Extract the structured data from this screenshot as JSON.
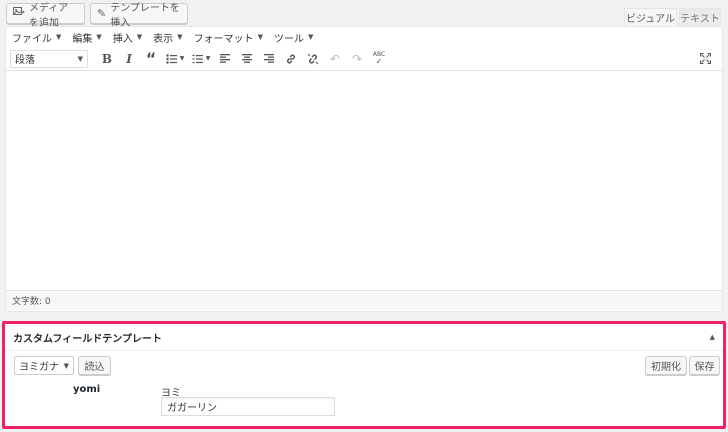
{
  "top_buttons": {
    "add_media": "メディアを追加",
    "insert_template": "テンプレートを挿入"
  },
  "mode_tabs": {
    "visual": "ビジュアル",
    "text": "テキスト"
  },
  "menubar": {
    "items": [
      "ファイル",
      "編集",
      "挿入",
      "表示",
      "フォーマット",
      "ツール"
    ]
  },
  "toolbar": {
    "format_value": "段落",
    "icons": [
      "bold-icon",
      "italic-icon",
      "blockquote-icon",
      "bullet-list-icon",
      "numbered-list-icon",
      "align-left-icon",
      "align-center-icon",
      "align-right-icon",
      "link-icon",
      "unlink-icon",
      "undo-icon",
      "redo-icon",
      "spellcheck-icon",
      "fullscreen-icon"
    ],
    "spellcheck_text": "ABC"
  },
  "status_bar": {
    "word_count": "文字数: 0"
  },
  "custom_field_template": {
    "title": "カスタムフィールドテンプレート",
    "template_select": "ヨミガナ",
    "load_button": "読込",
    "reset_button": "初期化",
    "save_button": "保存",
    "field_key": "yomi",
    "field_label": "ヨミ",
    "field_value": "ガガーリン"
  },
  "colors": {
    "highlight": "#f0206c"
  }
}
